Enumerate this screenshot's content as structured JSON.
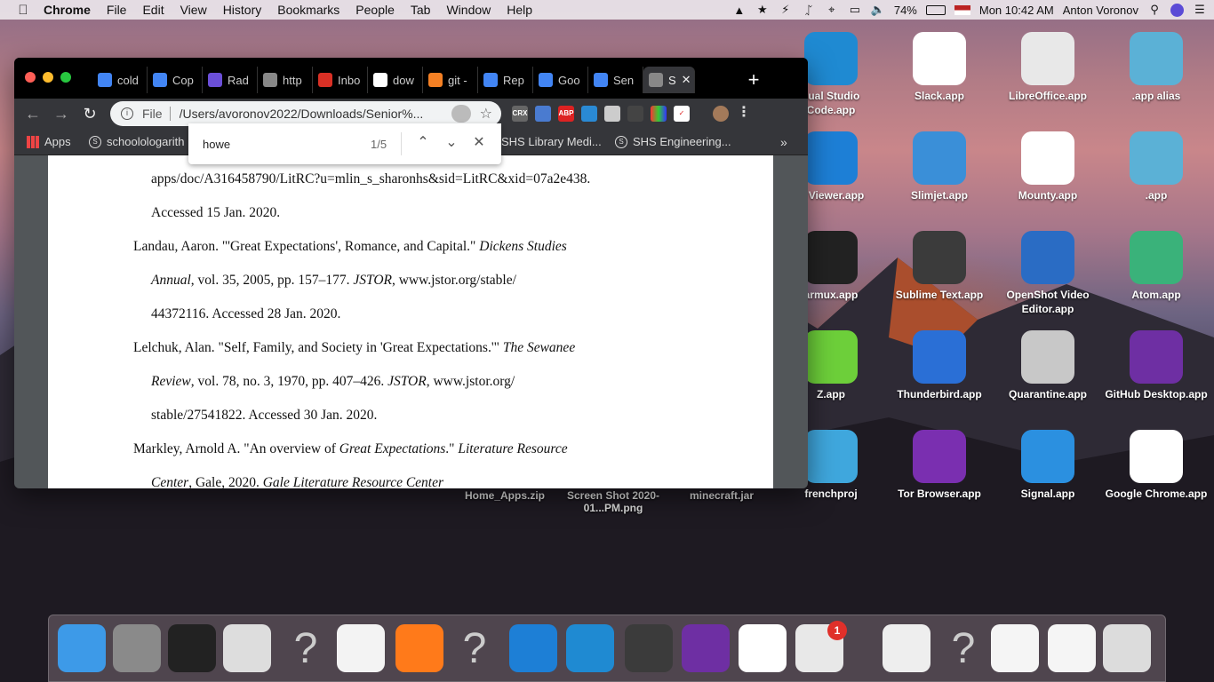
{
  "menubar": {
    "app": "Chrome",
    "items": [
      "File",
      "Edit",
      "View",
      "History",
      "Bookmarks",
      "People",
      "Tab",
      "Window",
      "Help"
    ],
    "battery": "74%",
    "clock": "Mon 10:42 AM",
    "user": "Anton Voronov"
  },
  "desktop_icons": [
    {
      "label": "sual Studio Code.app",
      "icon": "vscode-icon",
      "color": "#1f8ad2"
    },
    {
      "label": "Slack.app",
      "icon": "slack-icon",
      "color": "#ffffff"
    },
    {
      "label": "LibreOffice.app",
      "icon": "libreoffice-icon",
      "color": "#e8e8e8"
    },
    {
      "label": ".app alias",
      "icon": "app-alias-icon",
      "color": "#5bb1d6"
    },
    {
      "label": "C Viewer.app",
      "icon": "vnc-viewer-icon",
      "color": "#1d7fd6"
    },
    {
      "label": "Slimjet.app",
      "icon": "slimjet-icon",
      "color": "#3a8fd8"
    },
    {
      "label": "Mounty.app",
      "icon": "mounty-icon",
      "color": "#ffffff"
    },
    {
      "label": ".app",
      "icon": "app-icon",
      "color": "#5bb1d6"
    },
    {
      "label": "armux.app",
      "icon": "marmux-icon",
      "color": "#222222"
    },
    {
      "label": "Sublime Text.app",
      "icon": "sublime-text-icon",
      "color": "#3b3b3b"
    },
    {
      "label": "OpenShot Video Editor.app",
      "icon": "openshot-icon",
      "color": "#2a6cc4"
    },
    {
      "label": "Atom.app",
      "icon": "atom-icon",
      "color": "#3ab27a"
    },
    {
      "label": "Z.app",
      "icon": "z-app-icon",
      "color": "#6dcf3a"
    },
    {
      "label": "Thunderbird.app",
      "icon": "thunderbird-icon",
      "color": "#2a6fd6"
    },
    {
      "label": "Quarantine.app",
      "icon": "quarantine-icon",
      "color": "#c8c8c8"
    },
    {
      "label": "GitHub Desktop.app",
      "icon": "github-desktop-icon",
      "color": "#6e2fa3"
    },
    {
      "label": "frenchproj",
      "icon": "folder-icon",
      "color": "#3fa7dd"
    },
    {
      "label": "Tor Browser.app",
      "icon": "tor-browser-icon",
      "color": "#7a2fb0"
    },
    {
      "label": "Signal.app",
      "icon": "signal-icon",
      "color": "#2b90e0"
    },
    {
      "label": "Google Chrome.app",
      "icon": "chrome-icon",
      "color": "#ffffff"
    }
  ],
  "desktop_files": [
    {
      "label": "Home_Apps.zip"
    },
    {
      "label": "Screen Shot 2020-01...PM.png"
    },
    {
      "label": "minecraft.jar"
    }
  ],
  "chrome": {
    "tabs": [
      {
        "label": "cold",
        "icon": "docs-icon",
        "color": "#4285f4"
      },
      {
        "label": "Cop",
        "icon": "docs-icon",
        "color": "#4285f4"
      },
      {
        "label": "Rad",
        "icon": "x-icon",
        "color": "#6b4fd8"
      },
      {
        "label": "http",
        "icon": "globe-icon",
        "color": "#888888"
      },
      {
        "label": "Inbo",
        "icon": "gmail-icon",
        "color": "#d93025"
      },
      {
        "label": "dow",
        "icon": "google-icon",
        "color": "#ffffff"
      },
      {
        "label": "git -",
        "icon": "stackoverflow-icon",
        "color": "#f48024"
      },
      {
        "label": "Rep",
        "icon": "docs-icon",
        "color": "#4285f4"
      },
      {
        "label": "Goo",
        "icon": "docs-icon",
        "color": "#4285f4"
      },
      {
        "label": "Sen",
        "icon": "docs-icon",
        "color": "#4285f4"
      },
      {
        "label": "S",
        "icon": "globe-icon",
        "color": "#888888",
        "active": true
      }
    ],
    "omnibox": {
      "scheme": "File",
      "url": "/Users/avoronov2022/Downloads/Senior%..."
    },
    "bookmarks": [
      {
        "label": "Apps"
      },
      {
        "label": "schoolologarith"
      },
      {
        "label": "SHS Library Medi..."
      },
      {
        "label": "SHS Engineering..."
      }
    ],
    "find": {
      "query": "howe",
      "count": "1/5"
    }
  },
  "document": {
    "lines": [
      {
        "text": "apps/doc/A316458790/LitRC?u=mlin_s_sharonhs&sid=LitRC&xid=07a2e438.",
        "indent": true
      },
      {
        "text": "Accessed 15 Jan. 2020.",
        "indent": true
      },
      {
        "parts": [
          "Landau, Aaron. \"'Great Expectations', Romance, and Capital.\" ",
          "Dickens Studies"
        ],
        "indent": false
      },
      {
        "parts": [
          "Annual",
          ", vol. 35, 2005, pp. 157–177. ",
          "JSTOR",
          ", www.jstor.org/stable/"
        ],
        "indent": true
      },
      {
        "text": "44372116. Accessed 28 Jan. 2020.",
        "indent": true
      },
      {
        "parts": [
          "Lelchuk, Alan. \"Self, Family, and Society in 'Great Expectations.'\" ",
          "The Sewanee"
        ],
        "indent": false
      },
      {
        "parts": [
          "Review",
          ", vol. 78, no. 3, 1970, pp. 407–426. ",
          "JSTOR",
          ", www.jstor.org/"
        ],
        "indent": true
      },
      {
        "text": "stable/27541822. Accessed 30 Jan. 2020.",
        "indent": true
      },
      {
        "parts": [
          "Markley, Arnold A. \"An overview of ",
          "Great Expectations",
          ".\" ",
          "Literature Resource"
        ],
        "indent": false
      },
      {
        "parts": [
          "Center",
          ", Gale, 2020. ",
          "Gale Literature Resource Center"
        ],
        "indent": true
      }
    ]
  },
  "dock": {
    "items": [
      {
        "name": "finder-icon",
        "color": "#3d9ae8"
      },
      {
        "name": "system-preferences-icon",
        "color": "#8a8a8a"
      },
      {
        "name": "terminal-icon",
        "color": "#222222"
      },
      {
        "name": "script-editor-icon",
        "color": "#dddddd"
      },
      {
        "name": "unknown-app-icon",
        "color": "transparent"
      },
      {
        "name": "textedit-icon",
        "color": "#f3f3f3"
      },
      {
        "name": "firefox-icon",
        "color": "#ff7a1a"
      },
      {
        "name": "unknown-app-icon",
        "color": "transparent"
      },
      {
        "name": "vnc-viewer-icon",
        "color": "#1d7fd6"
      },
      {
        "name": "vscode-icon",
        "color": "#1f8ad2"
      },
      {
        "name": "sublime-text-icon",
        "color": "#3b3b3b"
      },
      {
        "name": "github-desktop-icon",
        "color": "#6e2fa3"
      },
      {
        "name": "chrome-icon",
        "color": "#ffffff"
      },
      {
        "name": "printer-icon",
        "color": "#e8e8e8",
        "badge": "1"
      },
      {
        "name": "document-icon",
        "color": "#eeeeee"
      },
      {
        "name": "unknown-app-icon",
        "color": "transparent"
      },
      {
        "name": "window-thumbnail-icon",
        "color": "#f5f5f5"
      },
      {
        "name": "window-thumbnail-icon",
        "color": "#f5f5f5"
      },
      {
        "name": "trash-icon",
        "color": "#dcdcdc"
      }
    ]
  }
}
